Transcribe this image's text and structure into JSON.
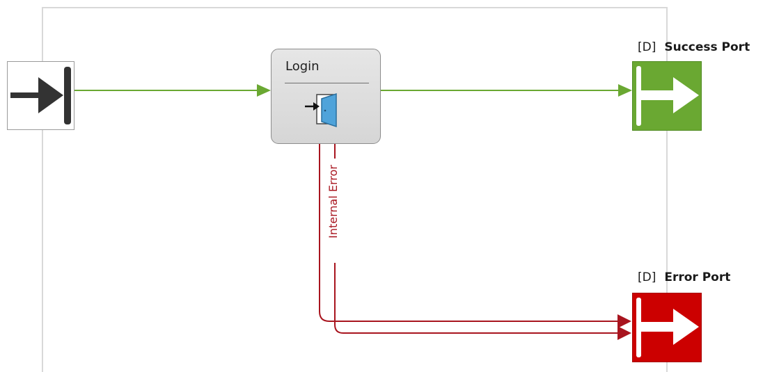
{
  "nodes": {
    "start": {
      "icon": "start-entry-icon"
    },
    "login": {
      "title": "Login",
      "icon": "login-door-icon"
    },
    "success_port": {
      "tag": "[D]",
      "name": "Success Port",
      "icon": "exit-arrow-icon",
      "color": "#6aa832"
    },
    "error_port": {
      "tag": "[D]",
      "name": "Error Port",
      "icon": "exit-arrow-icon",
      "color": "#cc0000"
    }
  },
  "edges": {
    "internal_error_label": "Internal Error",
    "success_color": "#6aa832",
    "error_color": "#a8141e"
  }
}
